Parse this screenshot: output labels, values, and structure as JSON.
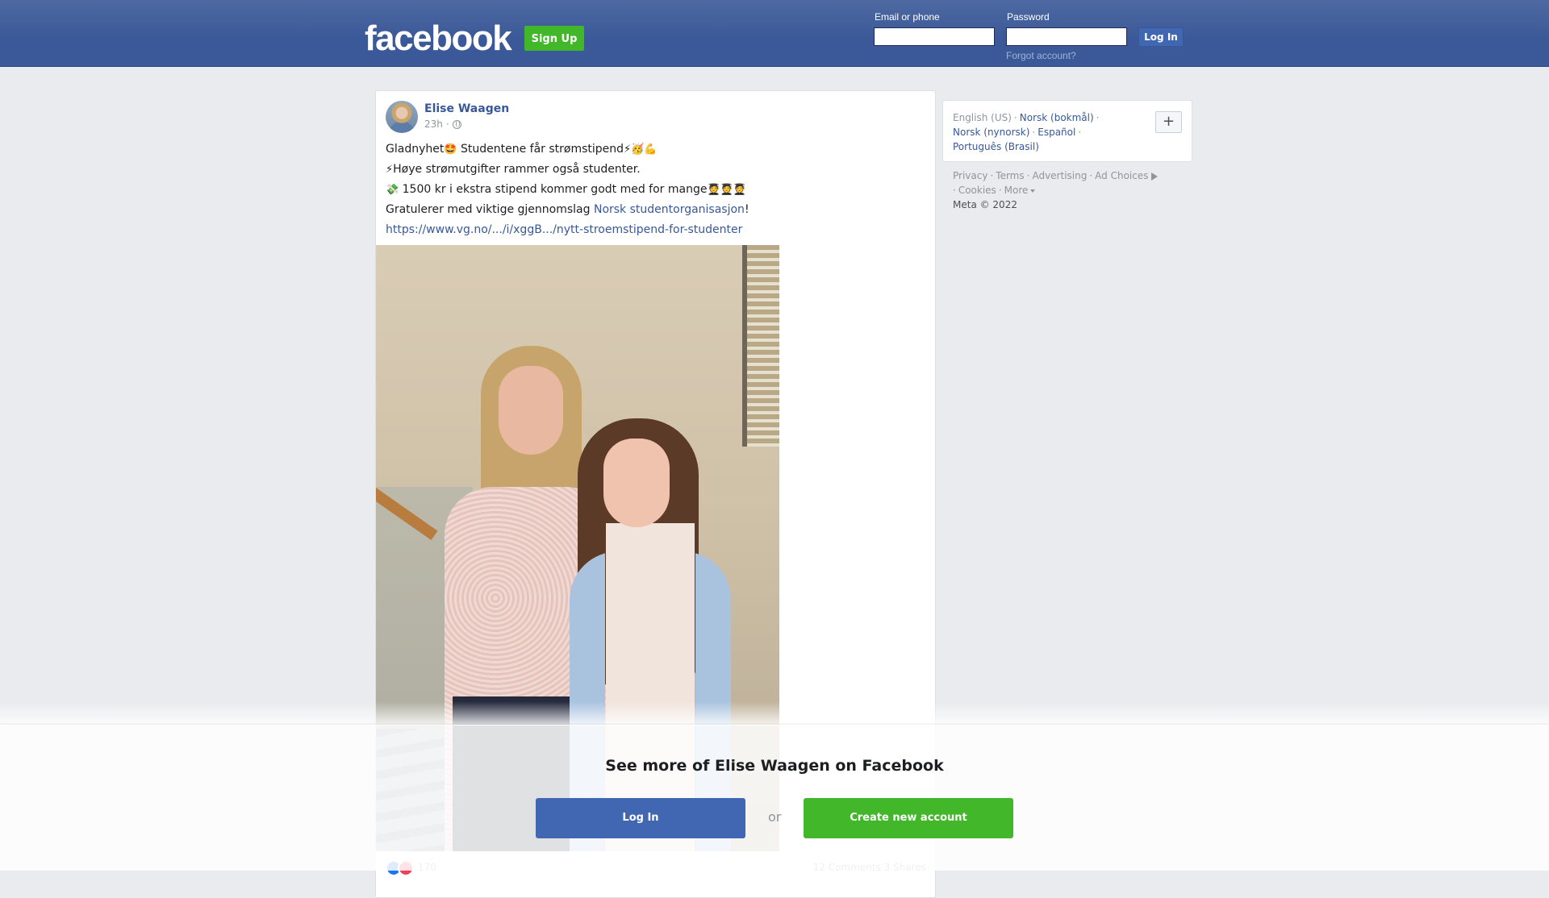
{
  "header": {
    "logo": "facebook",
    "signup_label": "Sign Up",
    "email_label": "Email or phone",
    "password_label": "Password",
    "login_label": "Log In",
    "forgot_label": "Forgot account?"
  },
  "post": {
    "author": "Elise Waagen",
    "time": "23h",
    "privacy_icon": "globe-icon",
    "lines": [
      {
        "emoji_before": "",
        "text": "Gladnyhet",
        "emoji_mid": "🤩",
        "text2": " Studentene får strømstipend",
        "emoji_after": "⚡🥳💪"
      },
      {
        "emoji_before": "⚡",
        "text": "Høye strømutgifter rammer også studenter.",
        "emoji_mid": "",
        "text2": "",
        "emoji_after": ""
      },
      {
        "emoji_before": "💸",
        "text": " 1500 kr i ekstra stipend kommer godt med for mange",
        "emoji_mid": "",
        "text2": "",
        "emoji_after": "🧑‍🎓🧑‍🎓🧑‍🎓"
      }
    ],
    "congrats_prefix": "Gratulerer med viktige gjennomslag ",
    "congrats_link": "Norsk studentorganisasjon",
    "congrats_suffix": "!",
    "url": "https://www.vg.no/.../i/xggB.../nytt-stroemstipend-for-studenter",
    "reaction_count": "170",
    "comments_shares": "12 Comments 3 Shares"
  },
  "languages": {
    "current": "English (US)",
    "others": [
      "Norsk (bokmål)",
      "Norsk (nynorsk)",
      "Español",
      "Português (Brasil)"
    ],
    "add_label": "+"
  },
  "footer": {
    "links": [
      "Privacy",
      "Terms",
      "Advertising",
      "Ad Choices",
      "Cookies",
      "More"
    ],
    "copyright": "Meta © 2022"
  },
  "bottom": {
    "title": "See more of Elise Waagen on Facebook",
    "login_label": "Log In",
    "or_label": "or",
    "create_label": "Create new account"
  },
  "colors": {
    "brand_blue": "#3b5998",
    "button_green": "#42b72a",
    "link_blue": "#385898"
  }
}
